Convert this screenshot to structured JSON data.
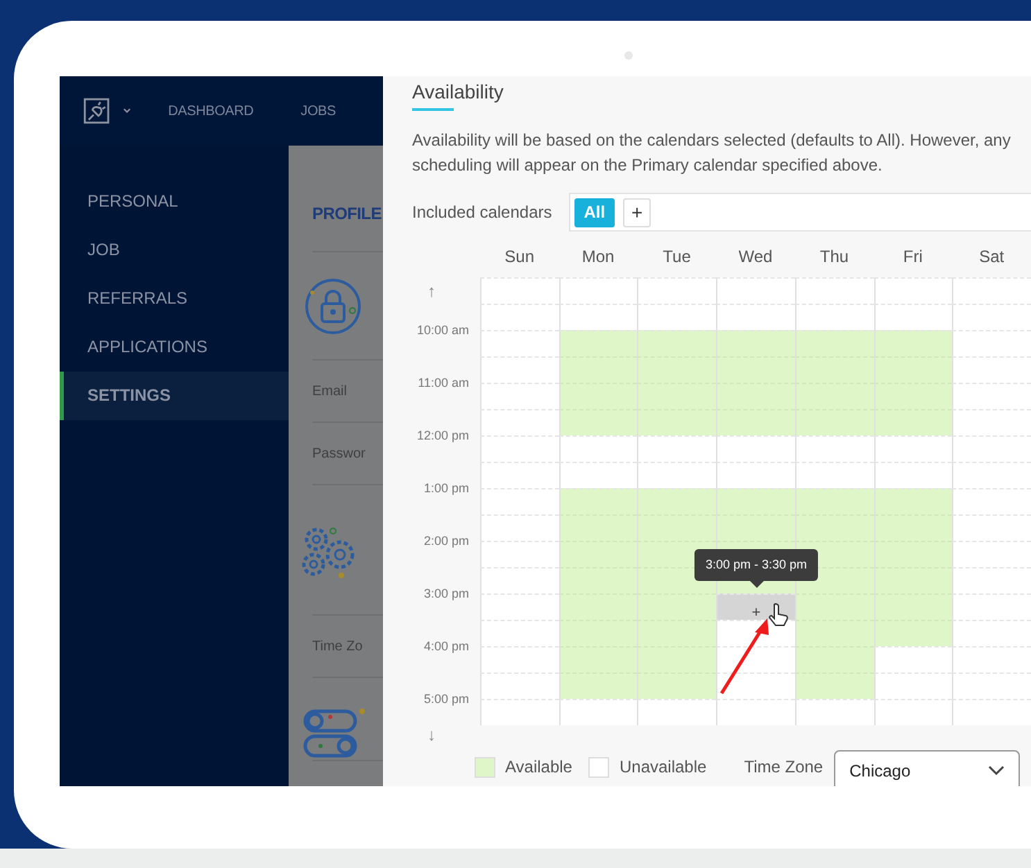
{
  "app": {
    "nav": {
      "items": [
        {
          "label": "DASHBOARD"
        },
        {
          "label": "JOBS"
        }
      ]
    },
    "sidebar": {
      "items": [
        {
          "label": "PERSONAL",
          "selected": false
        },
        {
          "label": "JOB",
          "selected": false
        },
        {
          "label": "REFERRALS",
          "selected": false
        },
        {
          "label": "APPLICATIONS",
          "selected": false
        },
        {
          "label": "SETTINGS",
          "selected": true
        }
      ]
    },
    "profile": {
      "title": "PROFILE",
      "rows": [
        {
          "kind": "lock"
        },
        {
          "kind": "field",
          "label": "Email"
        },
        {
          "kind": "field",
          "label": "Passwor"
        },
        {
          "kind": "gears"
        },
        {
          "kind": "field",
          "label": "Time Zo"
        },
        {
          "kind": "toggles"
        }
      ]
    }
  },
  "availability": {
    "title": "Availability",
    "description": "Availability will be based on the calendars selected (defaults to All). However, any scheduling will appear on the Primary calendar specified above.",
    "included_calendars": {
      "label": "Included calendars",
      "chips": [
        {
          "label": "All",
          "selected": true
        }
      ],
      "add": "+"
    },
    "calendar": {
      "scroll_up": "↑",
      "scroll_down": "↓",
      "times": [
        "10:00 am",
        "11:00 am",
        "12:00 pm",
        "1:00 pm",
        "2:00 pm",
        "3:00 pm",
        "4:00 pm",
        "5:00 pm"
      ],
      "days": [
        {
          "label": "Sun",
          "available": [
            false,
            false,
            false,
            false,
            false,
            false,
            false,
            false,
            false,
            false,
            false,
            false,
            false,
            false,
            false,
            false,
            false
          ],
          "hovered": [
            false,
            false,
            false,
            false,
            false,
            false,
            false,
            false,
            false,
            false,
            false,
            false,
            false,
            false,
            false,
            false,
            false
          ]
        },
        {
          "label": "Mon",
          "available": [
            false,
            false,
            true,
            true,
            true,
            true,
            false,
            false,
            true,
            true,
            true,
            true,
            true,
            true,
            true,
            true,
            false
          ],
          "hovered": [
            false,
            false,
            false,
            false,
            false,
            false,
            false,
            false,
            false,
            false,
            false,
            false,
            false,
            false,
            false,
            false,
            false
          ]
        },
        {
          "label": "Tue",
          "available": [
            false,
            false,
            true,
            true,
            true,
            true,
            false,
            false,
            true,
            true,
            true,
            true,
            true,
            true,
            true,
            true,
            false
          ],
          "hovered": [
            false,
            false,
            false,
            false,
            false,
            false,
            false,
            false,
            false,
            false,
            false,
            false,
            false,
            false,
            false,
            false,
            false
          ]
        },
        {
          "label": "Wed",
          "available": [
            false,
            false,
            true,
            true,
            true,
            true,
            false,
            false,
            true,
            true,
            true,
            true,
            false,
            false,
            false,
            false,
            false
          ],
          "hovered": [
            false,
            false,
            false,
            false,
            false,
            false,
            false,
            false,
            false,
            false,
            false,
            false,
            true,
            false,
            false,
            false,
            false
          ]
        },
        {
          "label": "Thu",
          "available": [
            false,
            false,
            true,
            true,
            true,
            true,
            false,
            false,
            true,
            true,
            true,
            true,
            true,
            true,
            true,
            true,
            false
          ],
          "hovered": [
            false,
            false,
            false,
            false,
            false,
            false,
            false,
            false,
            false,
            false,
            false,
            false,
            false,
            false,
            false,
            false,
            false
          ]
        },
        {
          "label": "Fri",
          "available": [
            false,
            false,
            true,
            true,
            true,
            true,
            false,
            false,
            true,
            true,
            true,
            true,
            true,
            true,
            false,
            false,
            false
          ],
          "hovered": [
            false,
            false,
            false,
            false,
            false,
            false,
            false,
            false,
            false,
            false,
            false,
            false,
            false,
            false,
            false,
            false,
            false
          ]
        },
        {
          "label": "Sat",
          "available": [
            false,
            false,
            false,
            false,
            false,
            false,
            false,
            false,
            false,
            false,
            false,
            false,
            false,
            false,
            false,
            false,
            false
          ],
          "hovered": [
            false,
            false,
            false,
            false,
            false,
            false,
            false,
            false,
            false,
            false,
            false,
            false,
            false,
            false,
            false,
            false,
            false
          ]
        }
      ],
      "hover": {
        "label": "+",
        "tooltip": "3:00 pm - 3:30 pm"
      }
    },
    "legend": [
      {
        "label": "Available",
        "color": "#dff7c8"
      },
      {
        "label": "Unavailable",
        "color": "#ffffff"
      }
    ],
    "time_zone": {
      "label": "Time Zone",
      "value": "Chicago"
    }
  }
}
